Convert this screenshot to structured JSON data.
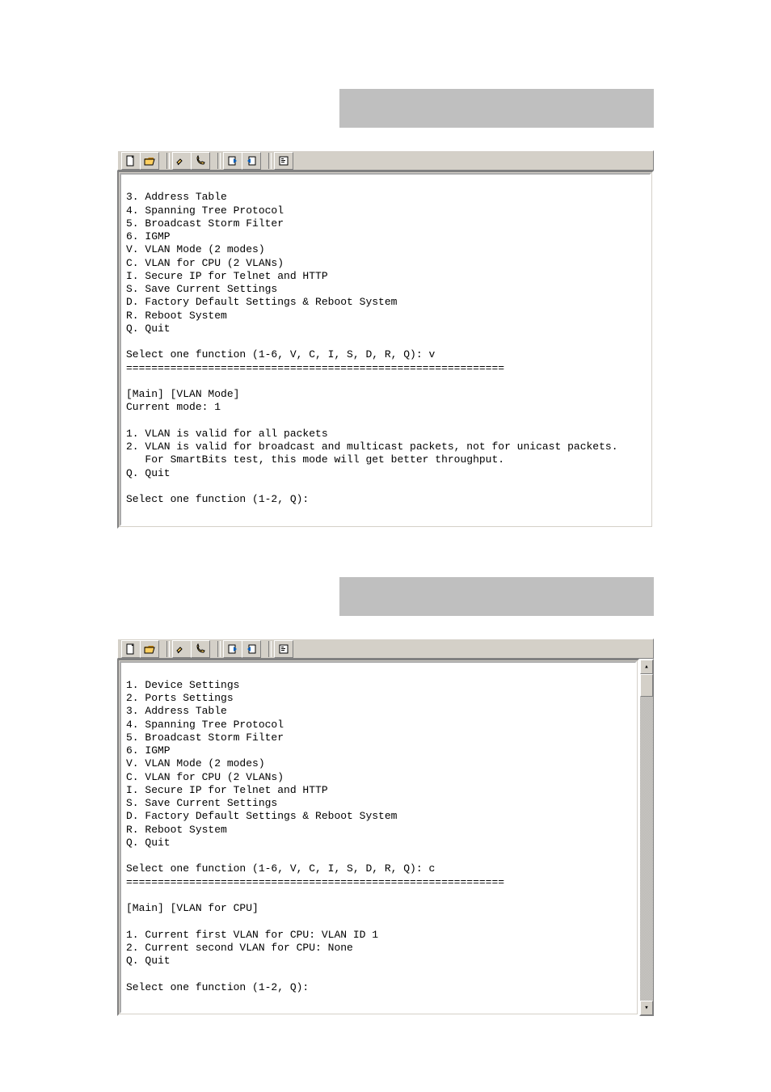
{
  "icons": {
    "new_doc": "new-doc-icon",
    "open": "open-folder-icon",
    "disconnect": "disconnect-icon",
    "call": "phone-icon",
    "send": "send-file-icon",
    "receive": "receive-file-icon",
    "properties": "properties-icon"
  },
  "window1": {
    "menu": [
      "3. Address Table",
      "4. Spanning Tree Protocol",
      "5. Broadcast Storm Filter",
      "6. IGMP",
      "V. VLAN Mode (2 modes)",
      "C. VLAN for CPU (2 VLANs)",
      "I. Secure IP for Telnet and HTTP",
      "S. Save Current Settings",
      "D. Factory Default Settings & Reboot System",
      "R. Reboot System",
      "Q. Quit"
    ],
    "select_prompt": "Select one function (1-6, V, C, I, S, D, R, Q): v",
    "separator": "============================================================",
    "breadcrumb": "[Main] [VLAN Mode]",
    "current_mode": "Current mode: 1",
    "options": [
      "1. VLAN is valid for all packets",
      "2. VLAN is valid for broadcast and multicast packets, not for unicast packets.",
      "   For SmartBits test, this mode will get better throughput.",
      "Q. Quit"
    ],
    "sub_prompt": "Select one function (1-2, Q):"
  },
  "window2": {
    "menu": [
      "1. Device Settings",
      "2. Ports Settings",
      "3. Address Table",
      "4. Spanning Tree Protocol",
      "5. Broadcast Storm Filter",
      "6. IGMP",
      "V. VLAN Mode (2 modes)",
      "C. VLAN for CPU (2 VLANs)",
      "I. Secure IP for Telnet and HTTP",
      "S. Save Current Settings",
      "D. Factory Default Settings & Reboot System",
      "R. Reboot System",
      "Q. Quit"
    ],
    "select_prompt": "Select one function (1-6, V, C, I, S, D, R, Q): c",
    "separator": "============================================================",
    "breadcrumb": "[Main] [VLAN for CPU]",
    "options": [
      "1. Current first VLAN for CPU: VLAN ID 1",
      "2. Current second VLAN for CPU: None",
      "Q. Quit"
    ],
    "sub_prompt": "Select one function (1-2, Q):"
  },
  "scrollbar": {
    "up": "▴",
    "down": "▾"
  }
}
